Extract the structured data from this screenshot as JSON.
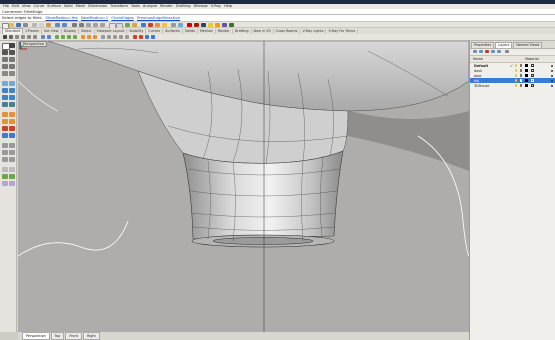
{
  "menu": [
    "File",
    "Edit",
    "View",
    "Curve",
    "Surface",
    "Solid",
    "Mesh",
    "Dimension",
    "Transform",
    "Tools",
    "Analyze",
    "Render",
    "Drafting",
    "Window",
    "V-Ray",
    "Help"
  ],
  "command_history": "Command: FilletEdge",
  "command_prompt": "Select edges to fillet",
  "command_options": [
    "ShowRadius=Yes",
    "NextRadius=1",
    "ChainEdges",
    "PreviousEdgeSelection"
  ],
  "toolbar_tabs": [
    "Standard",
    "CPlanes",
    "Set View",
    "Display",
    "Select",
    "Viewport Layout",
    "Visibility",
    "Curves",
    "Surfaces",
    "Solids",
    "Meshes",
    "Render",
    "Drafting",
    "New in V5",
    "Cross Rooms",
    "V-Ray Lights",
    "V-Ray For Rhino"
  ],
  "viewport": {
    "label": "Perspective"
  },
  "bottom_tabs": [
    "Perspective",
    "Top",
    "Front",
    "Right"
  ],
  "panel": {
    "tabs": [
      "Properties",
      "Layers",
      "Named Views"
    ],
    "columns": [
      "Name",
      "Material"
    ],
    "layers": [
      {
        "name": "Default",
        "check": "✓",
        "selected": false,
        "bold": true
      },
      {
        "name": "dash",
        "check": "",
        "selected": false,
        "bold": false
      },
      {
        "name": "pipe",
        "check": "",
        "selected": false,
        "bold": false
      },
      {
        "name": "hiji",
        "check": "",
        "selected": true,
        "bold": false
      },
      {
        "name": "3DHouse",
        "check": "",
        "selected": false,
        "bold": false
      }
    ]
  },
  "colors": {
    "accent": "#3d7ad6",
    "viewport_bg": "#aeadab",
    "title_bar": "#1c2a44"
  }
}
